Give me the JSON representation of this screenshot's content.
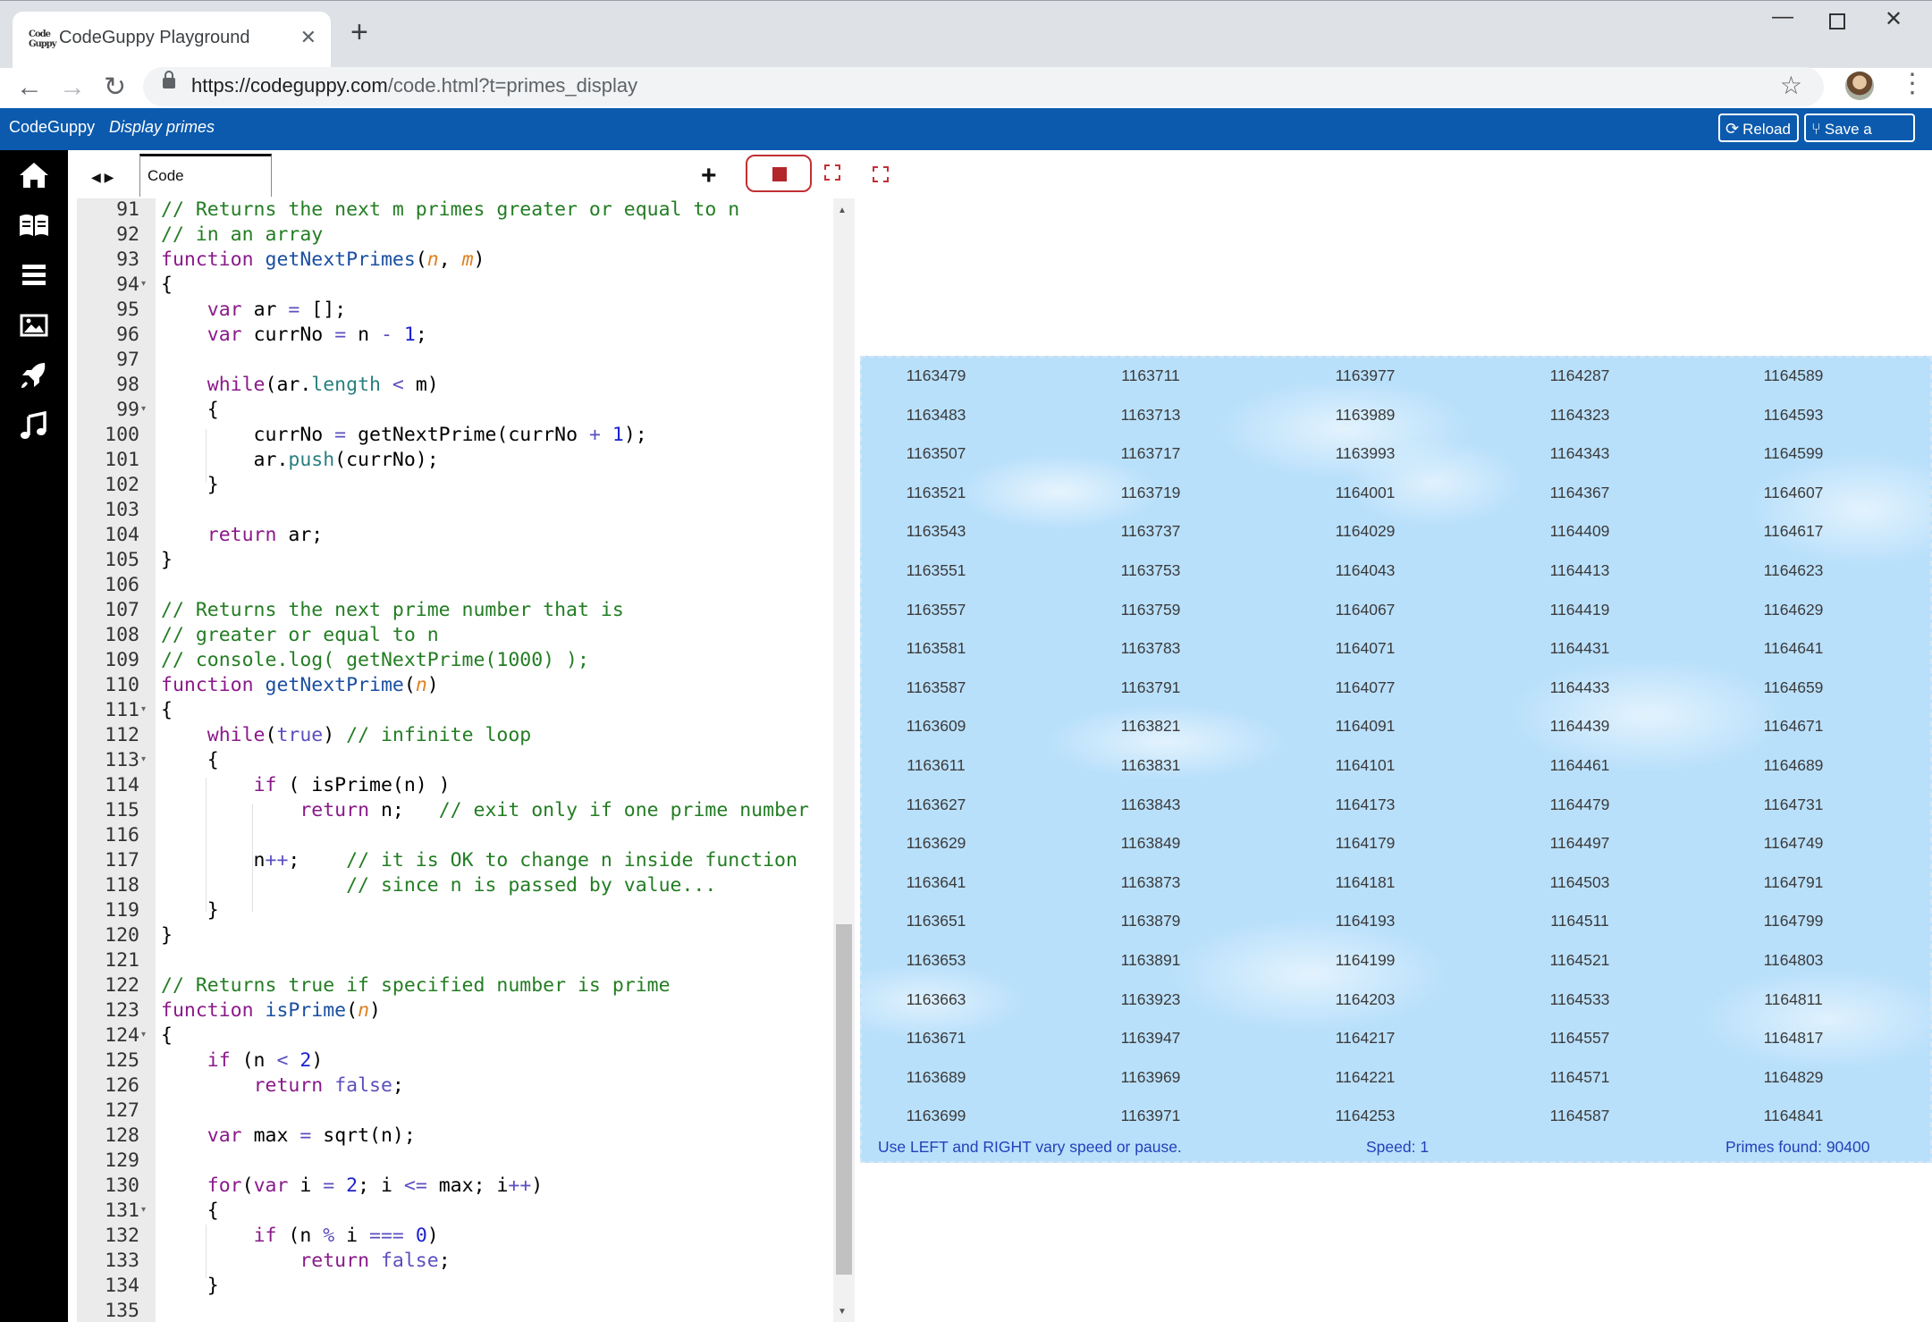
{
  "browser": {
    "tab_title": "CodeGuppy Playground",
    "tab_favicon_text": "Code\nGuppy",
    "url_host": "https://codeguppy.com",
    "url_path": "/code.html?t=primes_display"
  },
  "app": {
    "brand": "CodeGuppy",
    "doc_title": "Display primes",
    "reload_label": "Reload",
    "save_copy_label": "Save a copy"
  },
  "sidebar": {
    "items": [
      "home-icon",
      "book-icon",
      "list-icon",
      "image-icon",
      "rocket-icon",
      "music-icon"
    ]
  },
  "editor": {
    "tab_label": "Code",
    "line_numbers": [
      "91",
      "92",
      "93",
      "94",
      "95",
      "96",
      "97",
      "98",
      "99",
      "100",
      "101",
      "102",
      "103",
      "104",
      "105",
      "106",
      "107",
      "108",
      "109",
      "110",
      "111",
      "112",
      "113",
      "114",
      "115",
      "116",
      "117",
      "118",
      "119",
      "120",
      "121",
      "122",
      "123",
      "124",
      "125",
      "126",
      "127",
      "128",
      "129",
      "130",
      "131",
      "132",
      "133",
      "134",
      "135"
    ],
    "folds": [
      "94",
      "99",
      "111",
      "113",
      "124",
      "131"
    ]
  },
  "output": {
    "primes_columns": [
      [
        "1163479",
        "1163483",
        "1163507",
        "1163521",
        "1163543",
        "1163551",
        "1163557",
        "1163581",
        "1163587",
        "1163609",
        "1163611",
        "1163627",
        "1163629",
        "1163641",
        "1163651",
        "1163653",
        "1163663",
        "1163671",
        "1163689",
        "1163699"
      ],
      [
        "1163711",
        "1163713",
        "1163717",
        "1163719",
        "1163737",
        "1163753",
        "1163759",
        "1163783",
        "1163791",
        "1163821",
        "1163831",
        "1163843",
        "1163849",
        "1163873",
        "1163879",
        "1163891",
        "1163923",
        "1163947",
        "1163969",
        "1163971"
      ],
      [
        "1163977",
        "1163989",
        "1163993",
        "1164001",
        "1164029",
        "1164043",
        "1164067",
        "1164071",
        "1164077",
        "1164091",
        "1164101",
        "1164173",
        "1164179",
        "1164181",
        "1164193",
        "1164199",
        "1164203",
        "1164217",
        "1164221",
        "1164253"
      ],
      [
        "1164287",
        "1164323",
        "1164343",
        "1164367",
        "1164409",
        "1164413",
        "1164419",
        "1164431",
        "1164433",
        "1164439",
        "1164461",
        "1164479",
        "1164497",
        "1164503",
        "1164511",
        "1164521",
        "1164533",
        "1164557",
        "1164571",
        "1164587"
      ],
      [
        "1164589",
        "1164593",
        "1164599",
        "1164607",
        "1164617",
        "1164623",
        "1164629",
        "1164641",
        "1164659",
        "1164671",
        "1164689",
        "1164731",
        "1164749",
        "1164791",
        "1164799",
        "1164803",
        "1164811",
        "1164817",
        "1164829",
        "1164841"
      ]
    ],
    "hint": "Use LEFT and RIGHT vary speed or pause.",
    "speed": "Speed: 1",
    "primes_found": "Primes found: 90400"
  },
  "colors": {
    "appbar": "#0b5aad",
    "canvas_sky": "#b9e0fb",
    "stop_red": "#b3262a",
    "status_text": "#2440b8"
  }
}
